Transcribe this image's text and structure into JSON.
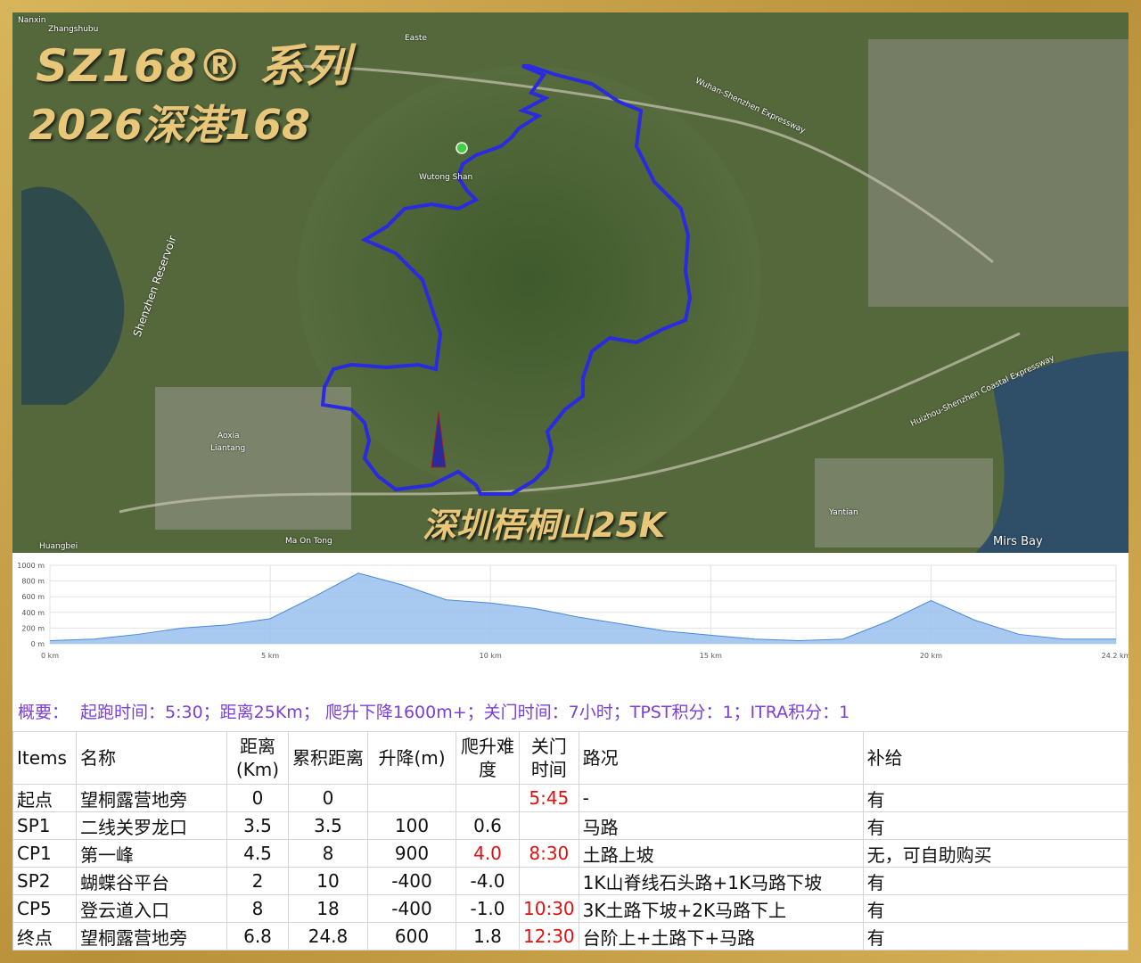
{
  "brand": {
    "line1": "SZ168® 系列",
    "line2": "2026深港168"
  },
  "map": {
    "race_title": "深圳梧桐山25K",
    "place_labels": [
      "Nanxin",
      "Zhangshubu",
      "Shenzhen Reservoir",
      "Wutong Shan",
      "Aoxia",
      "Liantang",
      "Huangbei",
      "Ma On Tong",
      "Yantian",
      "Mirs Bay",
      "Easte",
      "Wuhan-Shenzhen Expressway",
      "Huizhou-Shenzhen Coastal Expressway"
    ],
    "route_color": "#2a2ae0",
    "start_marker_color": "#40d040"
  },
  "profile": {
    "y_ticks": [
      "1000 m",
      "800 m",
      "600 m",
      "400 m",
      "200 m",
      "0 m"
    ],
    "x_ticks": [
      "0 km",
      "5 km",
      "10 km",
      "15 km",
      "20 km",
      "24.2 km"
    ],
    "elevation_km": [
      0,
      1,
      2,
      3,
      4,
      5,
      6,
      7,
      8,
      9,
      10,
      11,
      12,
      13,
      14,
      15,
      16,
      17,
      18,
      19,
      20,
      21,
      22,
      23,
      24.2
    ],
    "elevation_m": [
      40,
      60,
      120,
      200,
      240,
      320,
      600,
      900,
      750,
      560,
      520,
      450,
      340,
      250,
      160,
      110,
      60,
      40,
      60,
      280,
      550,
      300,
      120,
      60,
      60
    ],
    "fill_color": "#9fc3ee",
    "line_color": "#4a88d8"
  },
  "summary": {
    "label": "概要：",
    "text": "起跑时间：5:30；距离25Km；  爬升下降1600m+；关门时间：7小时；TPST积分：1；ITRA积分：1"
  },
  "table": {
    "headers": [
      "Items",
      "名称",
      "距离(Km)",
      "累积距离",
      "升降(m)",
      "爬升难度",
      "关门时间",
      "路况",
      "补给"
    ],
    "rows": [
      [
        "起点",
        "望桐露营地旁",
        "0",
        "0",
        "",
        "",
        "5:45",
        "-",
        "有"
      ],
      [
        "SP1",
        "二线关罗龙口",
        "3.5",
        "3.5",
        "100",
        "0.6",
        "",
        "马路",
        "有"
      ],
      [
        "CP1",
        "第一峰",
        "4.5",
        "8",
        "900",
        "4.0",
        "8:30",
        "土路上坡",
        "无，可自助购买"
      ],
      [
        "SP2",
        "蝴蝶谷平台",
        "2",
        "10",
        "-400",
        "-4.0",
        "",
        "1K山脊线石头路+1K马路下坡",
        "有"
      ],
      [
        "CP5",
        "登云道入口",
        "8",
        "18",
        "-400",
        "-1.0",
        "10:30",
        "3K土路下坡+2K马路下上",
        "有"
      ],
      [
        "终点",
        "望桐露营地旁",
        "6.8",
        "24.8",
        "600",
        "1.8",
        "12:30",
        "台阶上+土路下+马路",
        "有"
      ]
    ]
  }
}
